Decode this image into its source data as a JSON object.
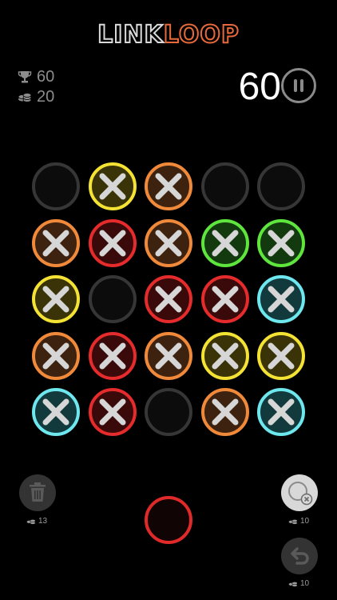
{
  "header": {
    "logo_part1": "LINK",
    "logo_part2": "LOOP"
  },
  "stats": {
    "best": "60",
    "coins": "20"
  },
  "score": "60",
  "grid": [
    [
      "empty",
      "yellow",
      "orange",
      "empty",
      "empty"
    ],
    [
      "orange",
      "red",
      "orange",
      "green",
      "green"
    ],
    [
      "yellow",
      "empty",
      "red",
      "red",
      "cyan"
    ],
    [
      "orange",
      "red",
      "orange",
      "yellow",
      "yellow"
    ],
    [
      "cyan",
      "red",
      "empty",
      "orange",
      "cyan"
    ]
  ],
  "colors": {
    "yellow": "#f4e234",
    "orange": "#f08a3a",
    "red": "#e52b2b",
    "green": "#5ee63e",
    "cyan": "#6ee7ee",
    "empty": "#363636"
  },
  "powerups": {
    "trash_cost": "13",
    "shuffle_cost": "10",
    "undo_cost": "10"
  }
}
